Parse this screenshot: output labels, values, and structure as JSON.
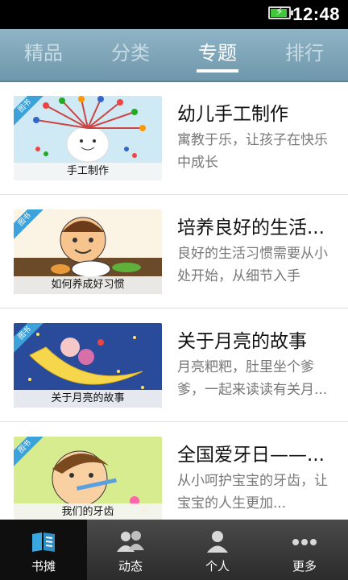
{
  "status_bar": {
    "time": "12:48"
  },
  "tabs": [
    {
      "label": "精品"
    },
    {
      "label": "分类"
    },
    {
      "label": "专题"
    },
    {
      "label": "排行"
    }
  ],
  "items": [
    {
      "ribbon": "图书",
      "caption": "手工制作",
      "title": "幼儿手工制作",
      "desc": "寓教于乐，让孩子在快乐中成长"
    },
    {
      "ribbon": "图书",
      "caption": "如何养成好习惯",
      "title": "培养良好的生活...",
      "desc": "良好的生活习惯需要从小处开始，从细节入手"
    },
    {
      "ribbon": "图书",
      "caption": "关于月亮的故事",
      "title": "关于月亮的故事",
      "desc": "月亮粑粑，肚里坐个爹爹，一起来读读有关月..."
    },
    {
      "ribbon": "图书",
      "caption": "我们的牙齿",
      "title": "全国爱牙日——...",
      "desc": "从小呵护宝宝的牙齿，让宝宝的人生更加..."
    }
  ],
  "bottom_nav": [
    {
      "label": "书摊",
      "icon": "bookstall-icon"
    },
    {
      "label": "动态",
      "icon": "people-icon"
    },
    {
      "label": "个人",
      "icon": "person-icon"
    },
    {
      "label": "更多",
      "icon": "more-icon"
    }
  ],
  "colors": {
    "tab_bar": "#7fa5b8",
    "ribbon": "#3ba3da",
    "accent": "#2f9fd8"
  }
}
